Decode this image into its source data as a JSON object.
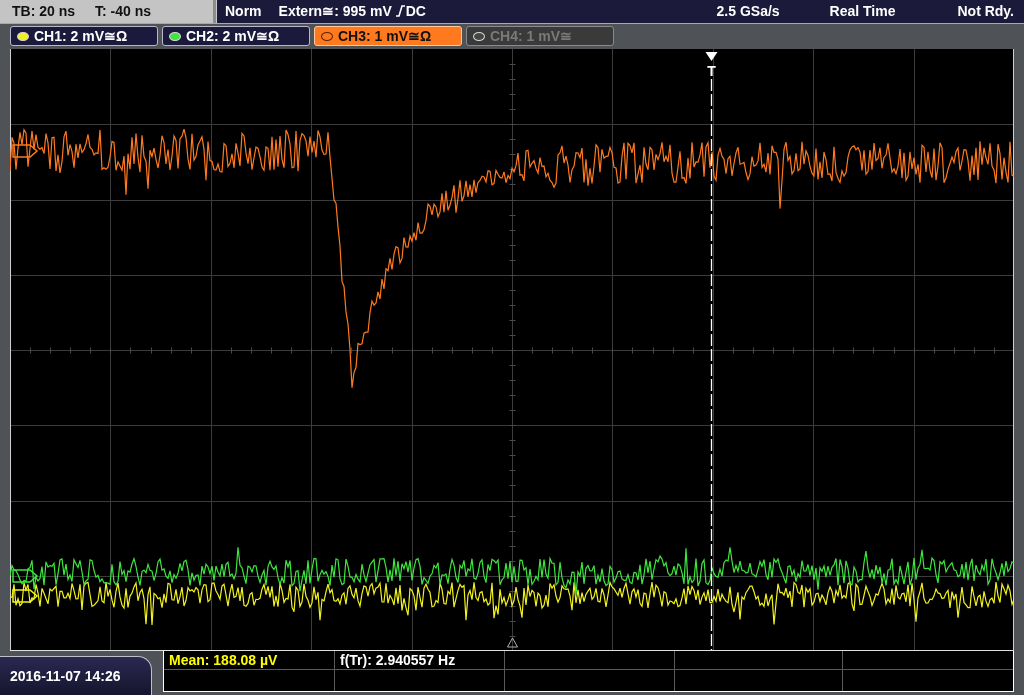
{
  "status_bar": {
    "timebase": "TB: 20 ns",
    "trigger_time": "T: -40 ns",
    "trigger_mode": "Norm",
    "trigger_source": "Extern≅: 995 mV",
    "trigger_coupling": "DC",
    "sample_rate": "2.5 GSa/s",
    "acquisition": "Real Time",
    "status": "Not Rdy."
  },
  "channels": [
    {
      "label": "CH1: 2 mV≅Ω",
      "color": "#f2f21e",
      "selected": false,
      "enabled": true
    },
    {
      "label": "CH2: 2 mV≅Ω",
      "color": "#3ee63e",
      "selected": false,
      "enabled": true
    },
    {
      "label": "CH3: 1 mV≅Ω",
      "color": "#ff7a1e",
      "selected": true,
      "enabled": true
    },
    {
      "label": "CH4: 1 mV≅",
      "color": "#464646",
      "selected": false,
      "enabled": false
    }
  ],
  "display": {
    "trigger_label": "T"
  },
  "measurements": [
    {
      "label": "Mean: 188.08 µV",
      "kind": "channel"
    },
    {
      "label": "f(Tr): 2.940557 Hz",
      "kind": "counter"
    }
  ],
  "timestamp": "2016-11-07 14:26"
}
